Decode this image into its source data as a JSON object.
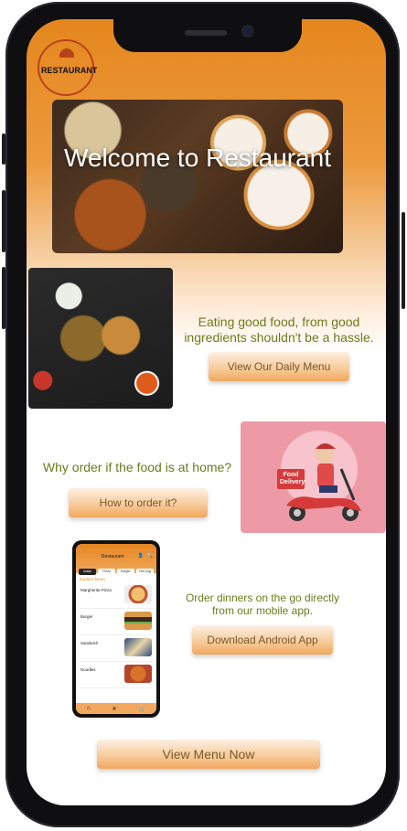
{
  "header": {
    "logo_text": "RESTAURANT"
  },
  "hero": {
    "title": "Welcome to Restaurant"
  },
  "section1": {
    "tagline": "Eating good food, from good ingredients shouldn't be a hassle.",
    "button_label": "View Our Daily Menu"
  },
  "section2": {
    "tagline": "Why order if the food is at home?",
    "button_label": "How to order it?",
    "image_label": "Food Delivery"
  },
  "section3": {
    "tagline": "Order dinners on the go directly from our mobile app.",
    "button_label": "Download Android App"
  },
  "mockup": {
    "title": "Restaurant",
    "chips": [
      "Indian",
      "Pizza",
      "Burger",
      "Hot Dog"
    ],
    "section_label": "Explore Menu",
    "items": [
      {
        "name": "Margherita Pizza"
      },
      {
        "name": "Burger"
      },
      {
        "name": "Sandwich"
      },
      {
        "name": "Noodles"
      }
    ]
  },
  "footer": {
    "button_label": "View Menu Now"
  },
  "colors": {
    "accent": "#e5861e",
    "tagline": "#6e7a1c",
    "button_text": "#7a5a2c"
  }
}
